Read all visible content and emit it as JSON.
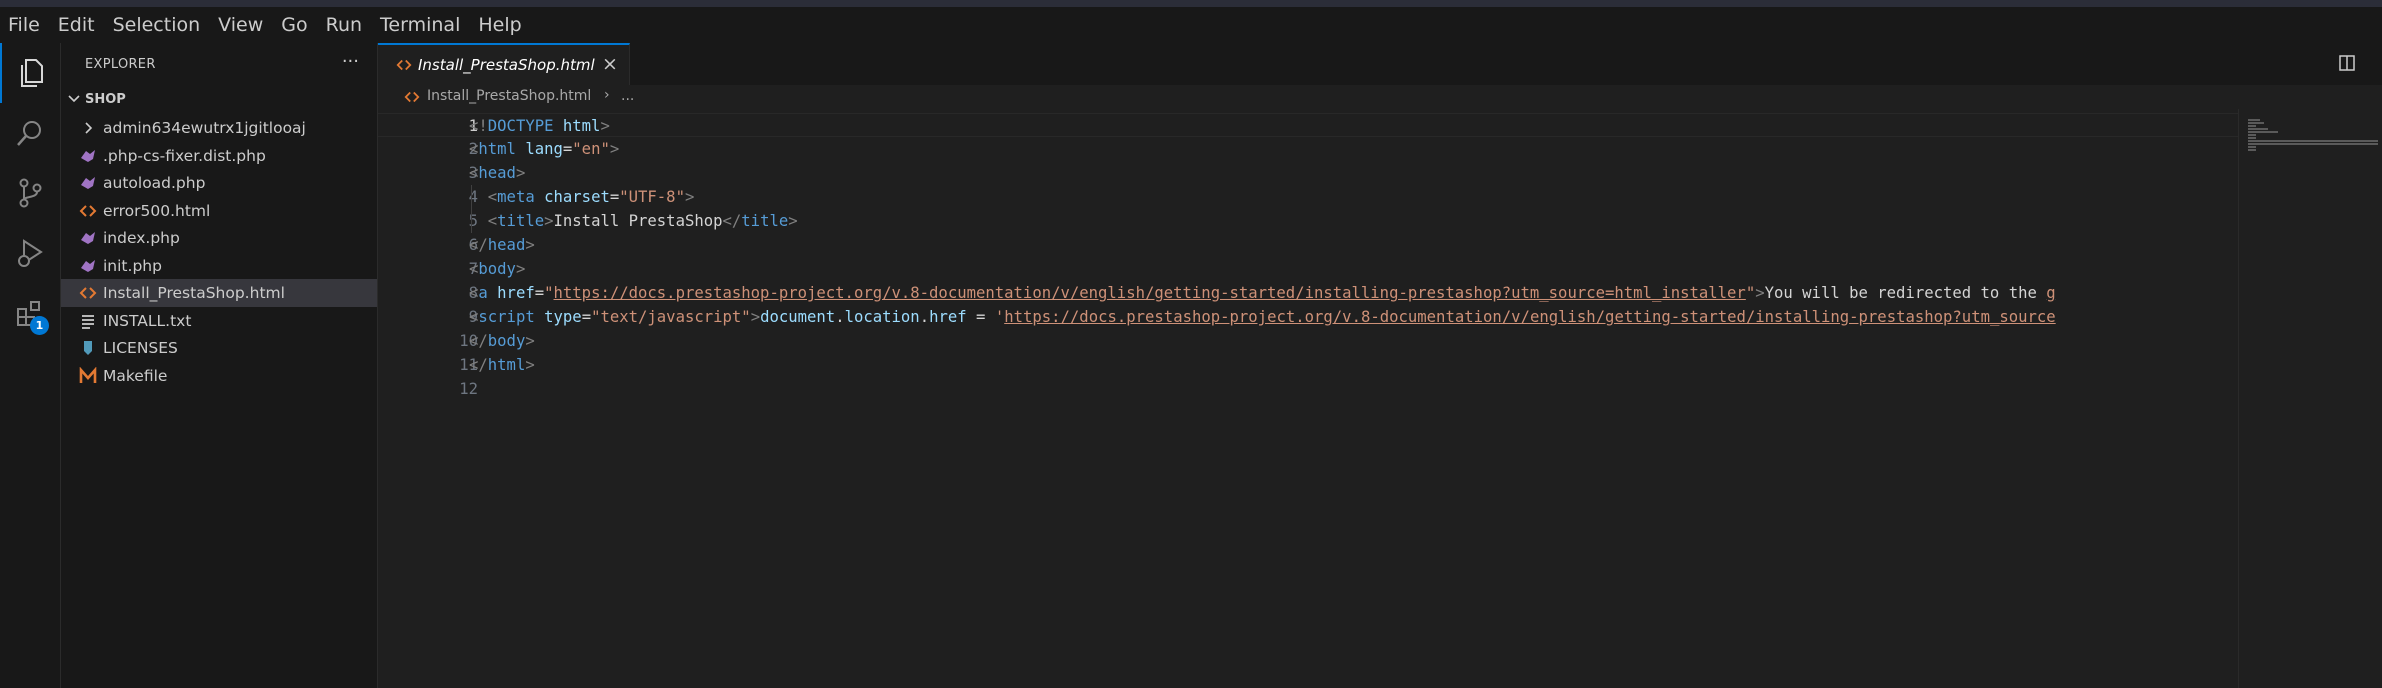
{
  "menu": [
    "File",
    "Edit",
    "Selection",
    "View",
    "Go",
    "Run",
    "Terminal",
    "Help"
  ],
  "activity": {
    "items": [
      "explorer-icon",
      "search-icon",
      "source-control-icon",
      "run-debug-icon",
      "extensions-icon"
    ],
    "extensions_badge": "1"
  },
  "explorer": {
    "title": "EXPLORER",
    "more": "···",
    "folder": "SHOP",
    "files": [
      {
        "name": "admin634ewutrx1jgitlooaj",
        "type": "folder",
        "icon": "chevron-right-icon"
      },
      {
        "name": ".php-cs-fixer.dist.php",
        "type": "php",
        "icon": "php-file-icon"
      },
      {
        "name": "autoload.php",
        "type": "php",
        "icon": "php-file-icon"
      },
      {
        "name": "error500.html",
        "type": "html",
        "icon": "html-file-icon"
      },
      {
        "name": "index.php",
        "type": "php",
        "icon": "php-file-icon"
      },
      {
        "name": "init.php",
        "type": "php",
        "icon": "php-file-icon"
      },
      {
        "name": "Install_PrestaShop.html",
        "type": "html",
        "icon": "html-file-icon",
        "selected": true
      },
      {
        "name": "INSTALL.txt",
        "type": "txt",
        "icon": "text-file-icon"
      },
      {
        "name": "LICENSES",
        "type": "license",
        "icon": "license-file-icon"
      },
      {
        "name": "Makefile",
        "type": "make",
        "icon": "makefile-icon"
      }
    ]
  },
  "editor": {
    "tab": {
      "label": "Install_PrestaShop.html",
      "close": "×"
    },
    "breadcrumb": {
      "file": "Install_PrestaShop.html",
      "sep": "›",
      "more": "..."
    },
    "lines": [
      {
        "n": "1",
        "indent": "",
        "tokens": [
          [
            "punc",
            "<!"
          ],
          [
            "tag",
            "DOCTYPE"
          ],
          [
            "plain",
            " "
          ],
          [
            "attr",
            "html"
          ],
          [
            "punc",
            ">"
          ]
        ]
      },
      {
        "n": "2",
        "indent": "",
        "tokens": [
          [
            "punc",
            "<"
          ],
          [
            "tag",
            "html"
          ],
          [
            "plain",
            " "
          ],
          [
            "attr",
            "lang"
          ],
          [
            "plain",
            "="
          ],
          [
            "str",
            "\"en\""
          ],
          [
            "punc",
            ">"
          ]
        ]
      },
      {
        "n": "3",
        "indent": "",
        "tokens": [
          [
            "punc",
            "<"
          ],
          [
            "tag",
            "head"
          ],
          [
            "punc",
            ">"
          ]
        ]
      },
      {
        "n": "4",
        "indent": "  ",
        "tokens": [
          [
            "punc",
            "<"
          ],
          [
            "tag",
            "meta"
          ],
          [
            "plain",
            " "
          ],
          [
            "attr",
            "charset"
          ],
          [
            "plain",
            "="
          ],
          [
            "str",
            "\"UTF-8\""
          ],
          [
            "punc",
            ">"
          ]
        ]
      },
      {
        "n": "5",
        "indent": "  ",
        "tokens": [
          [
            "punc",
            "<"
          ],
          [
            "tag",
            "title"
          ],
          [
            "punc",
            ">"
          ],
          [
            "plain",
            "Install PrestaShop"
          ],
          [
            "punc",
            "</"
          ],
          [
            "tag",
            "title"
          ],
          [
            "punc",
            ">"
          ]
        ]
      },
      {
        "n": "6",
        "indent": "",
        "tokens": [
          [
            "punc",
            "</"
          ],
          [
            "tag",
            "head"
          ],
          [
            "punc",
            ">"
          ]
        ]
      },
      {
        "n": "7",
        "indent": "",
        "tokens": [
          [
            "punc",
            "<"
          ],
          [
            "tag",
            "body"
          ],
          [
            "punc",
            ">"
          ]
        ]
      },
      {
        "n": "8",
        "indent": "",
        "tokens": [
          [
            "punc",
            "<"
          ],
          [
            "tag",
            "a"
          ],
          [
            "plain",
            " "
          ],
          [
            "attr",
            "href"
          ],
          [
            "plain",
            "="
          ],
          [
            "str",
            "\""
          ],
          [
            "url",
            "https://docs.prestashop-project.org/v.8-documentation/v/english/getting-started/installing-prestashop?utm_source=html_installer"
          ],
          [
            "str",
            "\""
          ],
          [
            "punc",
            ">"
          ],
          [
            "plain",
            "You will be redirected to the "
          ],
          [
            "url",
            "g"
          ]
        ]
      },
      {
        "n": "9",
        "indent": "",
        "tokens": [
          [
            "punc",
            "<"
          ],
          [
            "tag",
            "script"
          ],
          [
            "plain",
            " "
          ],
          [
            "attr",
            "type"
          ],
          [
            "plain",
            "="
          ],
          [
            "str",
            "\"text/javascript\""
          ],
          [
            "punc",
            ">"
          ],
          [
            "attr",
            "document"
          ],
          [
            "plain",
            "."
          ],
          [
            "attr",
            "location"
          ],
          [
            "plain",
            "."
          ],
          [
            "attr",
            "href"
          ],
          [
            "plain",
            " = "
          ],
          [
            "str",
            "'"
          ],
          [
            "url",
            "https://docs.prestashop-project.org/v.8-documentation/v/english/getting-started/installing-prestashop?utm_source"
          ]
        ]
      },
      {
        "n": "10",
        "indent": "",
        "tokens": [
          [
            "punc",
            "</"
          ],
          [
            "tag",
            "body"
          ],
          [
            "punc",
            ">"
          ]
        ]
      },
      {
        "n": "11",
        "indent": "",
        "tokens": [
          [
            "punc",
            "</"
          ],
          [
            "tag",
            "html"
          ],
          [
            "punc",
            ">"
          ]
        ]
      },
      {
        "n": "12",
        "indent": "",
        "tokens": []
      }
    ]
  },
  "colors": {
    "accent": "#0078d4",
    "tag": "#569cd6",
    "attr": "#9cdcfe",
    "string": "#ce9178",
    "php": "#a074c4",
    "html": "#e37933",
    "makefile": "#e37933",
    "license": "#519aba"
  }
}
